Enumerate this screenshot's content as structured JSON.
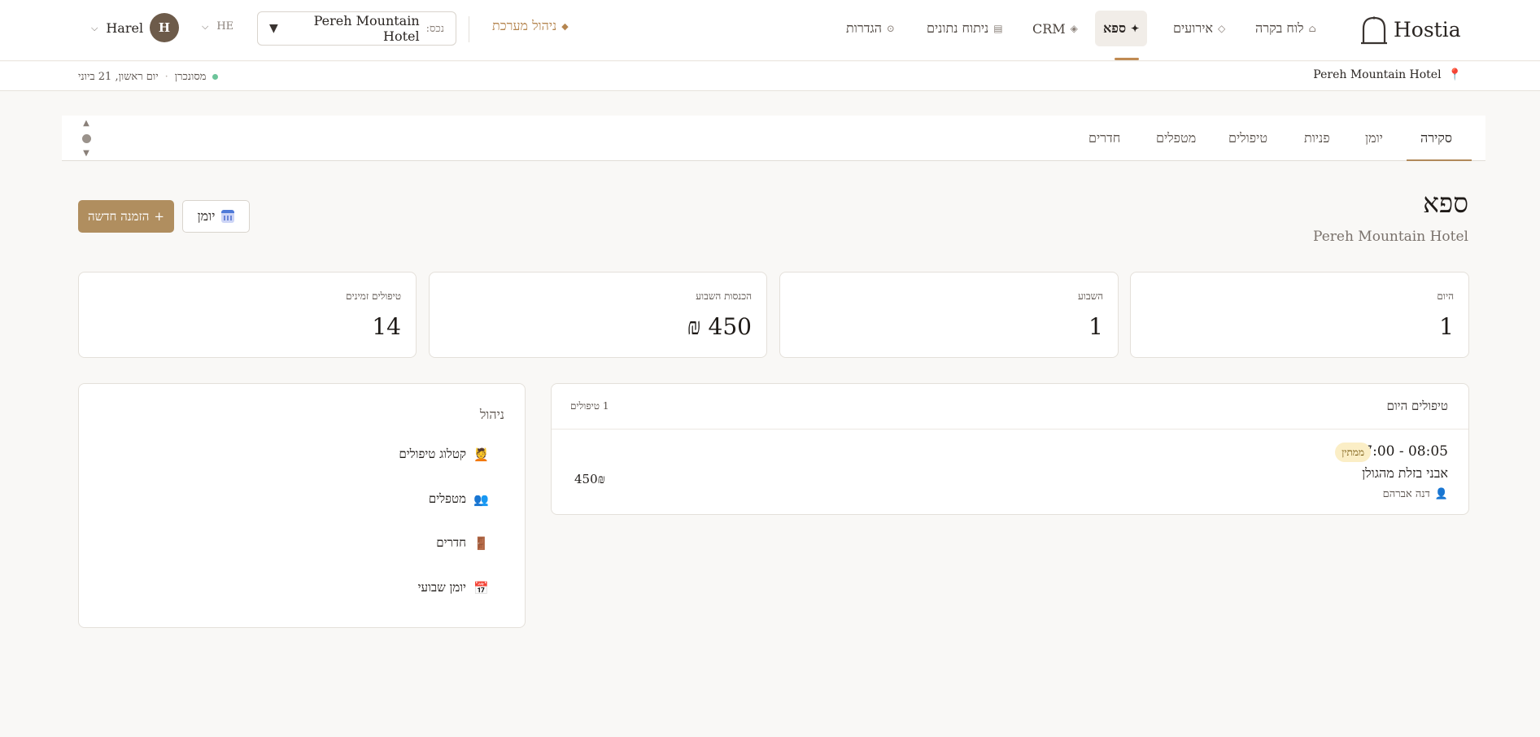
{
  "app": {
    "brand": "Hostia"
  },
  "nav": {
    "items": [
      {
        "label": "לוח בקרה",
        "icon": "⌂"
      },
      {
        "label": "אירועים",
        "icon": "◇"
      },
      {
        "label": "ספא",
        "icon": "✦"
      },
      {
        "label": "CRM",
        "icon": "◈"
      },
      {
        "label": "ניתוח נתונים",
        "icon": "▤"
      },
      {
        "label": "הגדרות",
        "icon": "⊙"
      }
    ],
    "system_management": "ניהול מערכת",
    "system_management_icon": "◆"
  },
  "property": {
    "prefix": "נכס:",
    "value": "Pereh Mountain Hotel"
  },
  "language": "HE",
  "user": {
    "initial": "H",
    "name": "Harel"
  },
  "subbar": {
    "hotel": "Pereh Mountain Hotel",
    "status": "מסונכרן",
    "date": "יום ראשון, 21 ביוני"
  },
  "tabs": [
    "סקירה",
    "יומן",
    "פניות",
    "טיפולים",
    "מטפלים",
    "חדרים"
  ],
  "page": {
    "title": "ספא",
    "subtitle": "Pereh Mountain Hotel",
    "new_booking": "הזמנה חדשה",
    "calendar_button": "יומן"
  },
  "stats": [
    {
      "label": "היום",
      "value": "1"
    },
    {
      "label": "השבוע",
      "value": "1"
    },
    {
      "label": "הכנסות השבוע",
      "value": "450 ₪"
    },
    {
      "label": "טיפולים זמינים",
      "value": "14"
    }
  ],
  "today": {
    "title": "טיפולים היום",
    "count": "1 טיפולים",
    "appointments": [
      {
        "time": "07:00 - 08:05",
        "status": "ממתין",
        "treatment": "אבני בזלת מהגולן",
        "therapist": "דנה אברהם",
        "price": "450₪"
      }
    ]
  },
  "management": {
    "title": "ניהול",
    "items": [
      {
        "label": "קטלוג טיפולים",
        "icon": "💆"
      },
      {
        "label": "מטפלים",
        "icon": "👥"
      },
      {
        "label": "חדרים",
        "icon": "🚪"
      },
      {
        "label": "יומן שבועי",
        "icon": "📅"
      }
    ]
  },
  "colors": {
    "accent": "#b08e5f",
    "active_underline": "#c08a52",
    "pending_badge": "#fbeec6"
  }
}
